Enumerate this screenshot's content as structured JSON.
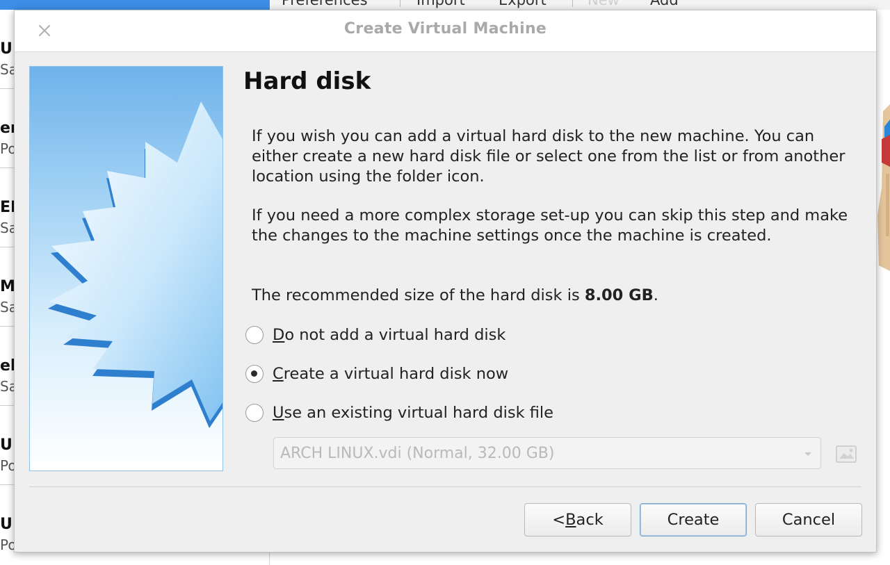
{
  "background": {
    "sidebar_rows": [
      {
        "line1": "U",
        "line2": "Sa"
      },
      {
        "line1": "er",
        "line2": "Po"
      },
      {
        "line1": "EN",
        "line2": "Sa"
      },
      {
        "line1": "MA",
        "line2": "Sa"
      },
      {
        "line1": "el",
        "line2": "Sa"
      },
      {
        "line1": "U",
        "line2": "Po"
      },
      {
        "line1": "U",
        "line2": "Po"
      }
    ],
    "toolbar": [
      "Preferences",
      "Import",
      "Export",
      "New",
      "Add"
    ]
  },
  "dialog": {
    "title": "Create Virtual Machine",
    "heading": "Hard disk",
    "paragraph1": "If you wish you can add a virtual hard disk to the new machine. You can either create a new hard disk file or select one from the list or from another location using the folder icon.",
    "paragraph2": "If you need a more complex storage set-up you can skip this step and make the changes to the machine settings once the machine is created.",
    "recommended_prefix": "The recommended size of the hard disk is ",
    "recommended_size": "8.00 GB",
    "recommended_suffix": ".",
    "options": [
      {
        "mnemonic": "D",
        "rest": "o not add a virtual hard disk",
        "checked": false
      },
      {
        "mnemonic": "C",
        "rest": "reate a virtual hard disk now",
        "checked": true
      },
      {
        "mnemonic": "U",
        "rest": "se an existing virtual hard disk file",
        "checked": false
      }
    ],
    "existing_disk_selected": "ARCH LINUX.vdi (Normal, 32.00 GB)",
    "buttons": {
      "back_prefix": "< ",
      "back_mnemonic": "B",
      "back_rest": "ack",
      "create": "Create",
      "cancel": "Cancel"
    },
    "colors": {
      "accent": "#3d8ee6",
      "banner_top": "#6fb2ea",
      "default_button_border": "#7ea6cc"
    }
  }
}
